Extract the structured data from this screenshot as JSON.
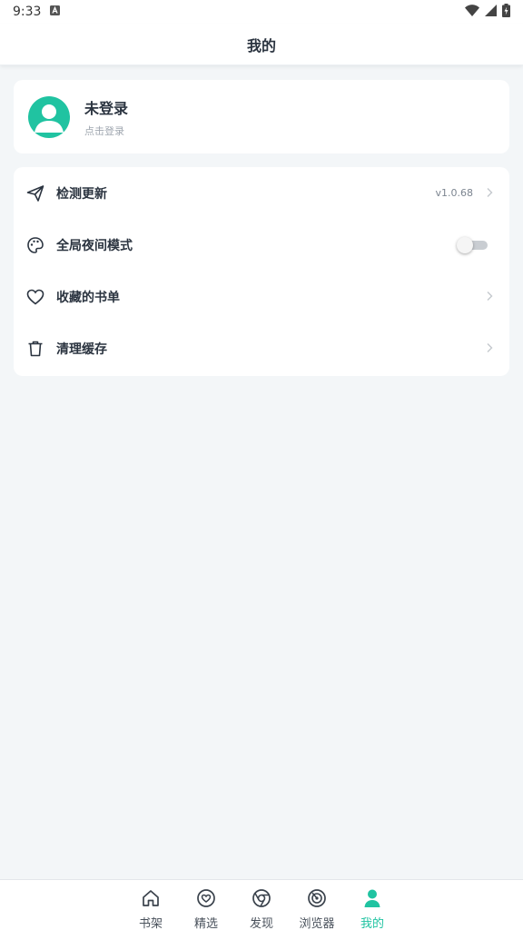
{
  "status_bar": {
    "time": "9:33",
    "left_icon": "a-notification-icon",
    "right_icons": [
      "wifi-icon",
      "signal-icon",
      "battery-charging-icon"
    ]
  },
  "header": {
    "title": "我的"
  },
  "profile": {
    "name": "未登录",
    "subtitle": "点击登录",
    "avatar_icon": "user-avatar-icon",
    "avatar_color": "#20c3a1"
  },
  "menu": {
    "items": [
      {
        "label": "检测更新",
        "icon": "paper-plane-icon",
        "value": "v1.0.68",
        "has_chevron": true
      },
      {
        "label": "全局夜间模式",
        "icon": "palette-icon",
        "toggle": false
      },
      {
        "label": "收藏的书单",
        "icon": "heart-icon",
        "has_chevron": true
      },
      {
        "label": "清理缓存",
        "icon": "trash-icon",
        "has_chevron": true
      }
    ]
  },
  "bottom_nav": {
    "items": [
      {
        "label": "书架",
        "icon": "home-icon",
        "active": false
      },
      {
        "label": "精选",
        "icon": "heart-circle-icon",
        "active": false
      },
      {
        "label": "发现",
        "icon": "chrome-icon",
        "active": false
      },
      {
        "label": "浏览器",
        "icon": "target-icon",
        "active": false
      },
      {
        "label": "我的",
        "icon": "user-icon",
        "active": true
      }
    ],
    "active_color": "#20c3a1"
  }
}
